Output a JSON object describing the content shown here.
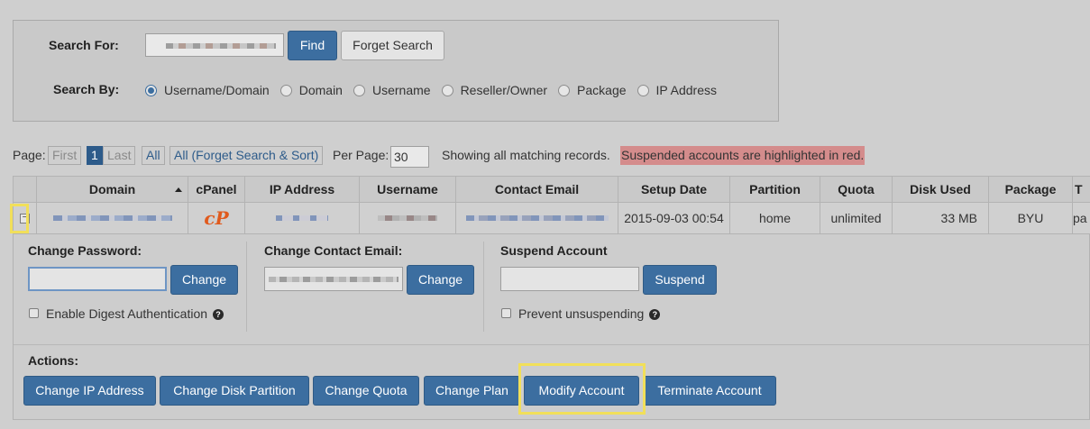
{
  "search": {
    "search_for_label": "Search For:",
    "find_label": "Find",
    "forget_label": "Forget Search",
    "search_by_label": "Search By:",
    "options": [
      "Username/Domain",
      "Domain",
      "Username",
      "Reseller/Owner",
      "Package",
      "IP Address"
    ],
    "selected": "Username/Domain"
  },
  "pager": {
    "page_label": "Page:",
    "first": "First",
    "current": "1",
    "last": "Last",
    "all": "All",
    "all_forget": "All (Forget Search & Sort)",
    "per_page_label": "Per Page:",
    "per_page_value": "30",
    "showing_text": "Showing all matching records.",
    "suspended_note": "Suspended accounts are highlighted in red."
  },
  "table": {
    "headers": [
      "Domain",
      "cPanel",
      "IP Address",
      "Username",
      "Contact Email",
      "Setup Date",
      "Partition",
      "Quota",
      "Disk Used",
      "Package",
      "T"
    ],
    "sort_icon": "sort-asc",
    "row": {
      "setup_date": "2015-09-03 00:54",
      "partition": "home",
      "quota": "unlimited",
      "disk_used": "33 MB",
      "package": "BYU",
      "theme": "pa"
    }
  },
  "panel": {
    "change_password_label": "Change Password:",
    "change_label": "Change",
    "digest_label": "Enable Digest Authentication",
    "change_email_label": "Change Contact Email:",
    "suspend_account_label": "Suspend Account",
    "suspend_btn": "Suspend",
    "prevent_label": "Prevent unsuspending",
    "actions_label": "Actions:",
    "actions": [
      "Change IP Address",
      "Change Disk Partition",
      "Change Quota",
      "Change Plan",
      "Modify Account",
      "Terminate Account"
    ]
  },
  "colors": {
    "accent": "#3c6ea0",
    "highlight": "#f1df5a",
    "suspended_bg": "#d48c8c",
    "cpanel_orange": "#e05a1d"
  }
}
